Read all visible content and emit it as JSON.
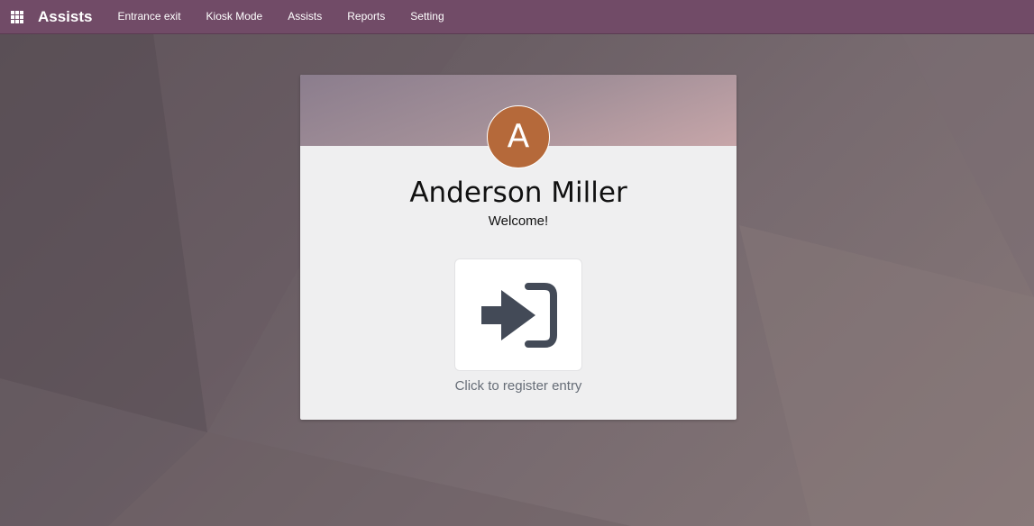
{
  "navbar": {
    "app_title": "Assists",
    "menu": [
      {
        "label": "Entrance exit"
      },
      {
        "label": "Kiosk Mode"
      },
      {
        "label": "Assists"
      },
      {
        "label": "Reports"
      },
      {
        "label": "Setting"
      }
    ],
    "background_color": "#714b67"
  },
  "card": {
    "avatar_initial": "A",
    "avatar_color": "#b5693a",
    "employee_name": "Anderson Miller",
    "greeting": "Welcome!",
    "action_icon": "sign-in-icon",
    "action_caption": "Click to register entry"
  }
}
